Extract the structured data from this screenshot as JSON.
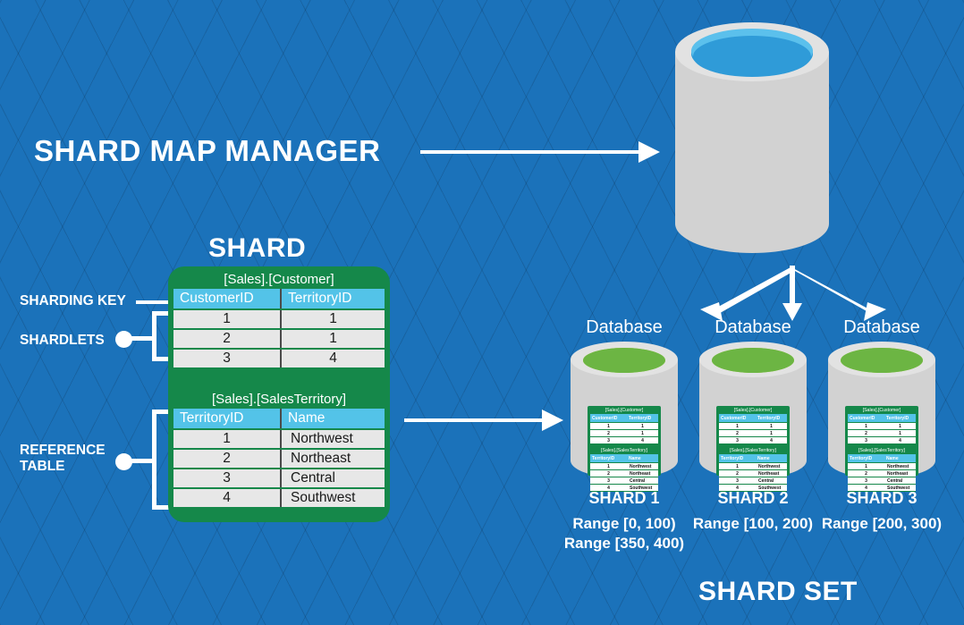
{
  "titles": {
    "shard_map_manager": "SHARD MAP MANAGER",
    "shard": "SHARD",
    "shard_set": "SHARD SET"
  },
  "callouts": {
    "sharding_key": "SHARDING KEY",
    "shardlets": "SHARDLETS",
    "reference_table_line1": "REFERENCE",
    "reference_table_line2": "TABLE"
  },
  "shard_card": {
    "customer_table": {
      "caption": "[Sales].[Customer]",
      "columns": [
        "CustomerID",
        "TerritoryID"
      ],
      "rows": [
        [
          "1",
          "1"
        ],
        [
          "2",
          "1"
        ],
        [
          "3",
          "4"
        ]
      ]
    },
    "territory_table": {
      "caption": "[Sales].[SalesTerritory]",
      "columns": [
        "TerritoryID",
        "Name"
      ],
      "rows": [
        [
          "1",
          "Northwest"
        ],
        [
          "2",
          "Northeast"
        ],
        [
          "3",
          "Central"
        ],
        [
          "4",
          "Southwest"
        ]
      ]
    }
  },
  "shards": [
    {
      "database_label": "Database",
      "name": "SHARD 1",
      "ranges": [
        "Range [0, 100)",
        "Range [350, 400)"
      ]
    },
    {
      "database_label": "Database",
      "name": "SHARD 2",
      "ranges": [
        "Range [100, 200)"
      ]
    },
    {
      "database_label": "Database",
      "name": "SHARD 3",
      "ranges": [
        "Range [200, 300)"
      ]
    }
  ],
  "colors": {
    "background": "#1B72BA",
    "card_green": "#15884A",
    "table_header": "#53C3E8",
    "table_row": "#E7E7E7",
    "cylinder_body": "#D2D2D2",
    "cylinder_top_blue": "#2F9BD8",
    "cylinder_top_green": "#7BC144",
    "accent_white": "#FFFFFF"
  }
}
